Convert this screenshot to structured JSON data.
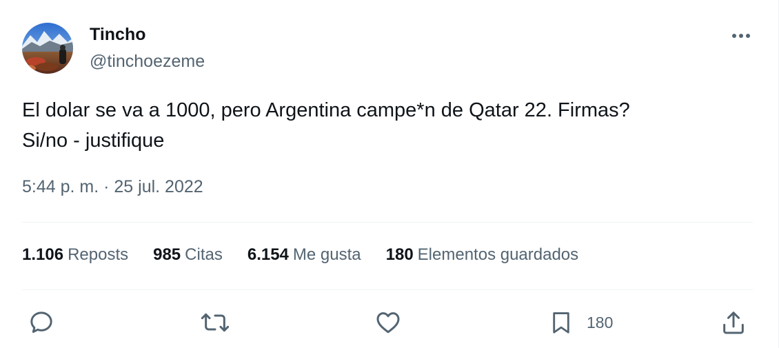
{
  "author": {
    "display_name": "Tincho",
    "handle": "@tinchoezeme",
    "avatar_icon": "avatar-mountain-landscape"
  },
  "tweet": {
    "text_lines": [
      "El dolar se va a 1000, pero Argentina campe*n de Qatar 22. Firmas?",
      "Si/no - justifique"
    ],
    "time": "5:44 p. m.",
    "separator": " · ",
    "date": "25 jul. 2022"
  },
  "stats": [
    {
      "value": "1.106",
      "label": "Reposts"
    },
    {
      "value": "985",
      "label": "Citas"
    },
    {
      "value": "6.154",
      "label": "Me gusta"
    },
    {
      "value": "180",
      "label": "Elementos guardados"
    }
  ],
  "actions": {
    "reply_icon": "reply-icon",
    "repost_icon": "repost-icon",
    "like_icon": "heart-icon",
    "bookmark_icon": "bookmark-icon",
    "bookmark_count": "180",
    "share_icon": "share-icon",
    "more_icon": "more-options-icon"
  },
  "colors": {
    "text_primary": "#0f1419",
    "text_secondary": "#536471",
    "divider": "#eff3f4"
  }
}
